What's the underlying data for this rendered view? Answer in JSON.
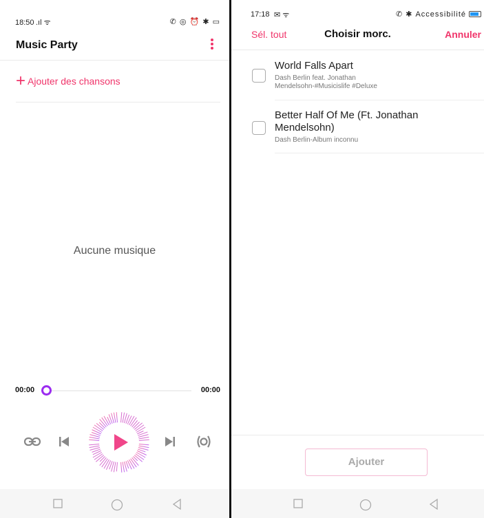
{
  "left": {
    "status": {
      "time": "18:50",
      "icons": "✆ ◎ ⏰ ✱ ▭"
    },
    "header": {
      "title": "Music Party",
      "menu_icon": "more-vert-icon"
    },
    "add_songs_label": "Ajouter des chansons",
    "empty_text": "Aucune musique",
    "player": {
      "elapsed": "00:00",
      "total": "00:00",
      "progress_percent": 0,
      "buttons": [
        "link-icon",
        "previous-icon",
        "play-icon",
        "next-icon",
        "broadcast-icon"
      ]
    },
    "colors": {
      "accent": "#f0346a",
      "thumb": "#9b2cf0"
    }
  },
  "right": {
    "status": {
      "time": "17:18",
      "accessibility": "Accessibilité"
    },
    "header": {
      "select_all": "Sél. tout",
      "title": "Choisir morc.",
      "cancel": "Annuler"
    },
    "songs": [
      {
        "title": "World Falls Apart",
        "meta_lines": [
          "Dash Berlin feat. Jonathan",
          "Mendelsohn-#Musicislife #Deluxe"
        ],
        "checked": false
      },
      {
        "title_lines": [
          "Better Half Of Me (Ft. Jonathan",
          "Mendelsohn)"
        ],
        "meta": "Dash Berlin-Album inconnu",
        "checked": false
      }
    ],
    "add_button": "Ajouter"
  },
  "navbar": {
    "buttons": [
      "recents-square-icon",
      "home-circle-icon",
      "back-triangle-icon"
    ]
  }
}
